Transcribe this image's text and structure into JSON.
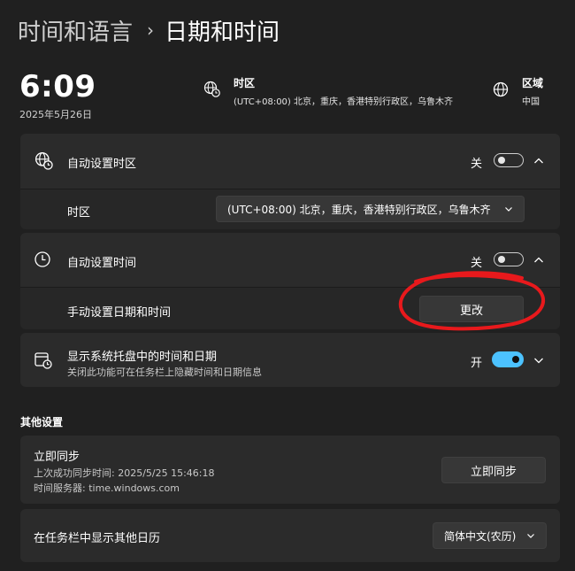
{
  "breadcrumb": {
    "parent": "时间和语言",
    "separator": "›",
    "current": "日期和时间"
  },
  "clock": {
    "time": "6:09",
    "date": "2025年5月26日"
  },
  "timezone_info": {
    "label": "时区",
    "value": "(UTC+08:00) 北京，重庆，香港特别行政区，乌鲁木齐",
    "icon": "globe-clock-icon"
  },
  "region_info": {
    "label": "区域",
    "value": "中国",
    "icon": "globe-icon"
  },
  "auto_timezone": {
    "label": "自动设置时区",
    "state_text": "关",
    "toggle_on": false,
    "icon": "globe-clock-icon",
    "sub": {
      "label": "时区",
      "dropdown_value": "(UTC+08:00) 北京，重庆，香港特别行政区，乌鲁木齐"
    }
  },
  "auto_time": {
    "label": "自动设置时间",
    "state_text": "关",
    "toggle_on": false,
    "icon": "clock-icon",
    "sub": {
      "label": "手动设置日期和时间",
      "button_label": "更改"
    }
  },
  "tray": {
    "label": "显示系统托盘中的时间和日期",
    "desc": "关闭此功能可在任务栏上隐藏时间和日期信息",
    "state_text": "开",
    "toggle_on": true,
    "icon": "calendar-clock-icon"
  },
  "other_settings": {
    "title": "其他设置"
  },
  "sync": {
    "title": "立即同步",
    "last_sync": "上次成功同步时间: 2025/5/25 15:46:18",
    "server": "时间服务器: time.windows.com",
    "button_label": "立即同步"
  },
  "calendar": {
    "label": "在任务栏中显示其他日历",
    "dropdown_value": "简体中文(农历)"
  },
  "colors": {
    "accent": "#4cc2ff",
    "annotation": "#e8191c"
  }
}
